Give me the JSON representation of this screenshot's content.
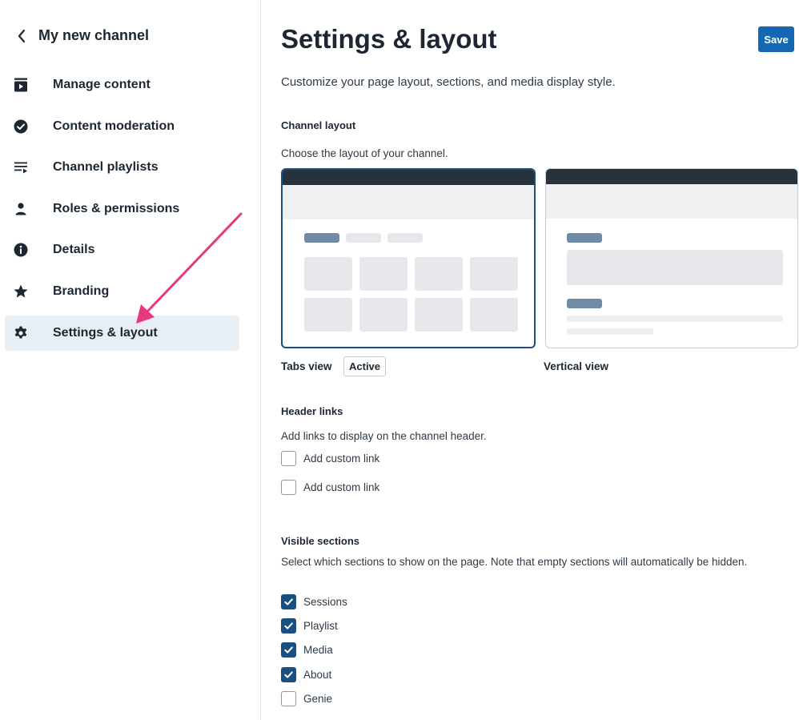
{
  "sidebar": {
    "back_title": "My new channel",
    "items": [
      {
        "label": "Manage content",
        "icon": "play-box-icon"
      },
      {
        "label": "Content moderation",
        "icon": "check-circle-icon"
      },
      {
        "label": "Channel playlists",
        "icon": "playlist-icon"
      },
      {
        "label": "Roles & permissions",
        "icon": "person-icon"
      },
      {
        "label": "Details",
        "icon": "info-icon"
      },
      {
        "label": "Branding",
        "icon": "star-icon"
      },
      {
        "label": "Settings & layout",
        "icon": "gear-icon",
        "active": true
      }
    ]
  },
  "main": {
    "title": "Settings & layout",
    "save_label": "Save",
    "subtitle": "Customize your page layout, sections, and media display style.",
    "channel_layout": {
      "heading": "Channel layout",
      "description": "Choose the layout of your channel.",
      "options": [
        {
          "label": "Tabs view",
          "badge": "Active",
          "selected": true
        },
        {
          "label": "Vertical view",
          "selected": false
        }
      ]
    },
    "header_links": {
      "heading": "Header links",
      "description": "Add links to display on the channel header.",
      "links": [
        {
          "label": "Add custom link",
          "checked": false
        },
        {
          "label": "Add custom link",
          "checked": false
        }
      ]
    },
    "visible_sections": {
      "heading": "Visible sections",
      "description": "Select which sections to show on the page. Note that empty sections will automatically be hidden.",
      "items": [
        {
          "label": "Sessions",
          "checked": true
        },
        {
          "label": "Playlist",
          "checked": true
        },
        {
          "label": "Media",
          "checked": true
        },
        {
          "label": "About",
          "checked": true
        },
        {
          "label": "Genie",
          "checked": false
        }
      ]
    }
  },
  "colors": {
    "primary": "#1567b3",
    "selected_border": "#1a4f82",
    "active_nav_bg": "#e7eef4",
    "annotation_arrow": "#e8367f"
  }
}
